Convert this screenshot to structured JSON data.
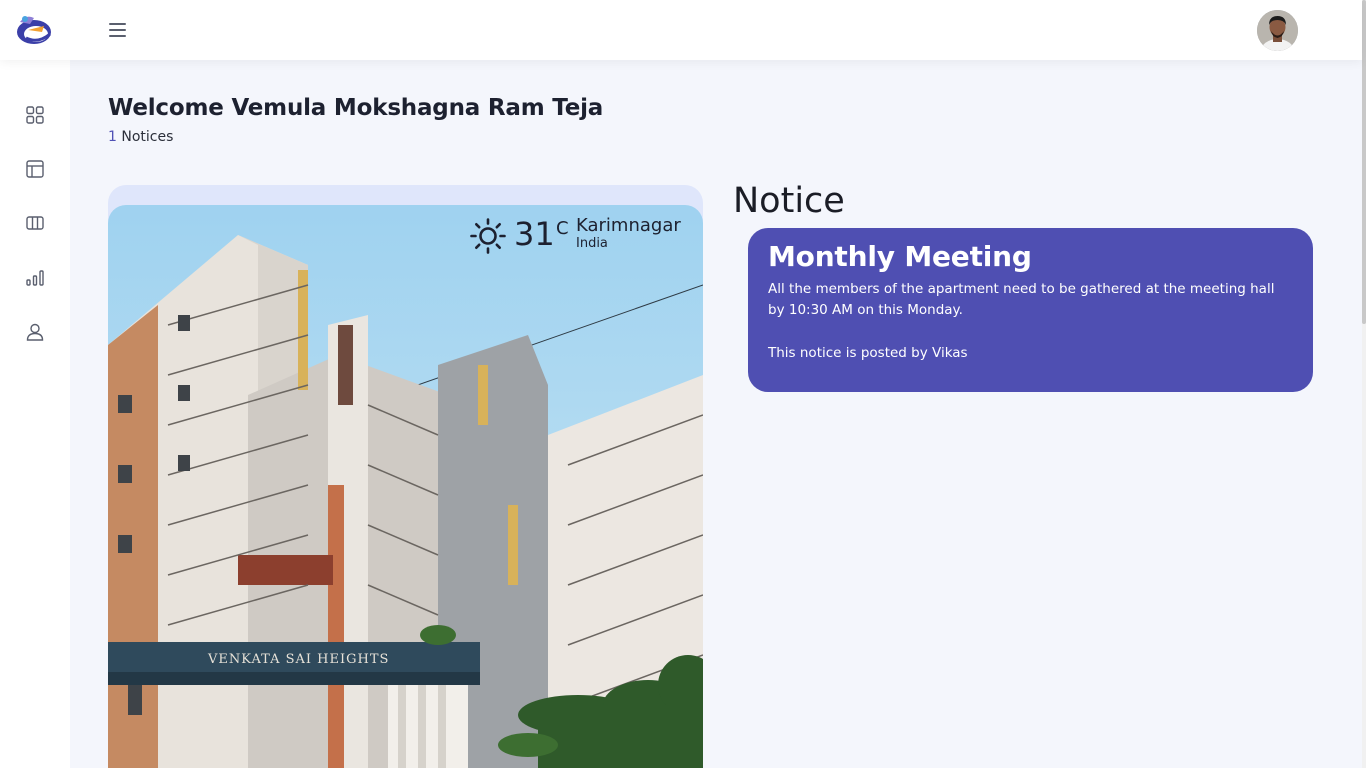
{
  "app": {
    "logo_icon": "apartment-logo-icon",
    "menu_icon": "hamburger-icon",
    "avatar_alt": "user-avatar"
  },
  "sidebar": {
    "items": [
      {
        "icon": "dashboard-grid-icon"
      },
      {
        "icon": "layout-icon"
      },
      {
        "icon": "columns-icon"
      },
      {
        "icon": "bar-chart-icon"
      },
      {
        "icon": "user-icon"
      }
    ]
  },
  "main": {
    "welcome": "Welcome Vemula Mokshagna Ram Teja",
    "notices_count": "1",
    "notices_label": "Notices"
  },
  "weather": {
    "icon": "sun-icon",
    "temperature": "31",
    "unit": "C",
    "city": "Karimnagar",
    "country": "India"
  },
  "building": {
    "sign": "VENKATA SAI HEIGHTS"
  },
  "notice": {
    "heading": "Notice",
    "card": {
      "title": "Monthly Meeting",
      "body": "All the members of the apartment need to be gathered at the meeting hall by 10:30 AM on this Monday.",
      "author": "This notice is posted by Vikas"
    }
  },
  "colors": {
    "accent": "#4f4fb2",
    "background": "#f4f6fc",
    "photo_frame": "#dfe6fb"
  }
}
